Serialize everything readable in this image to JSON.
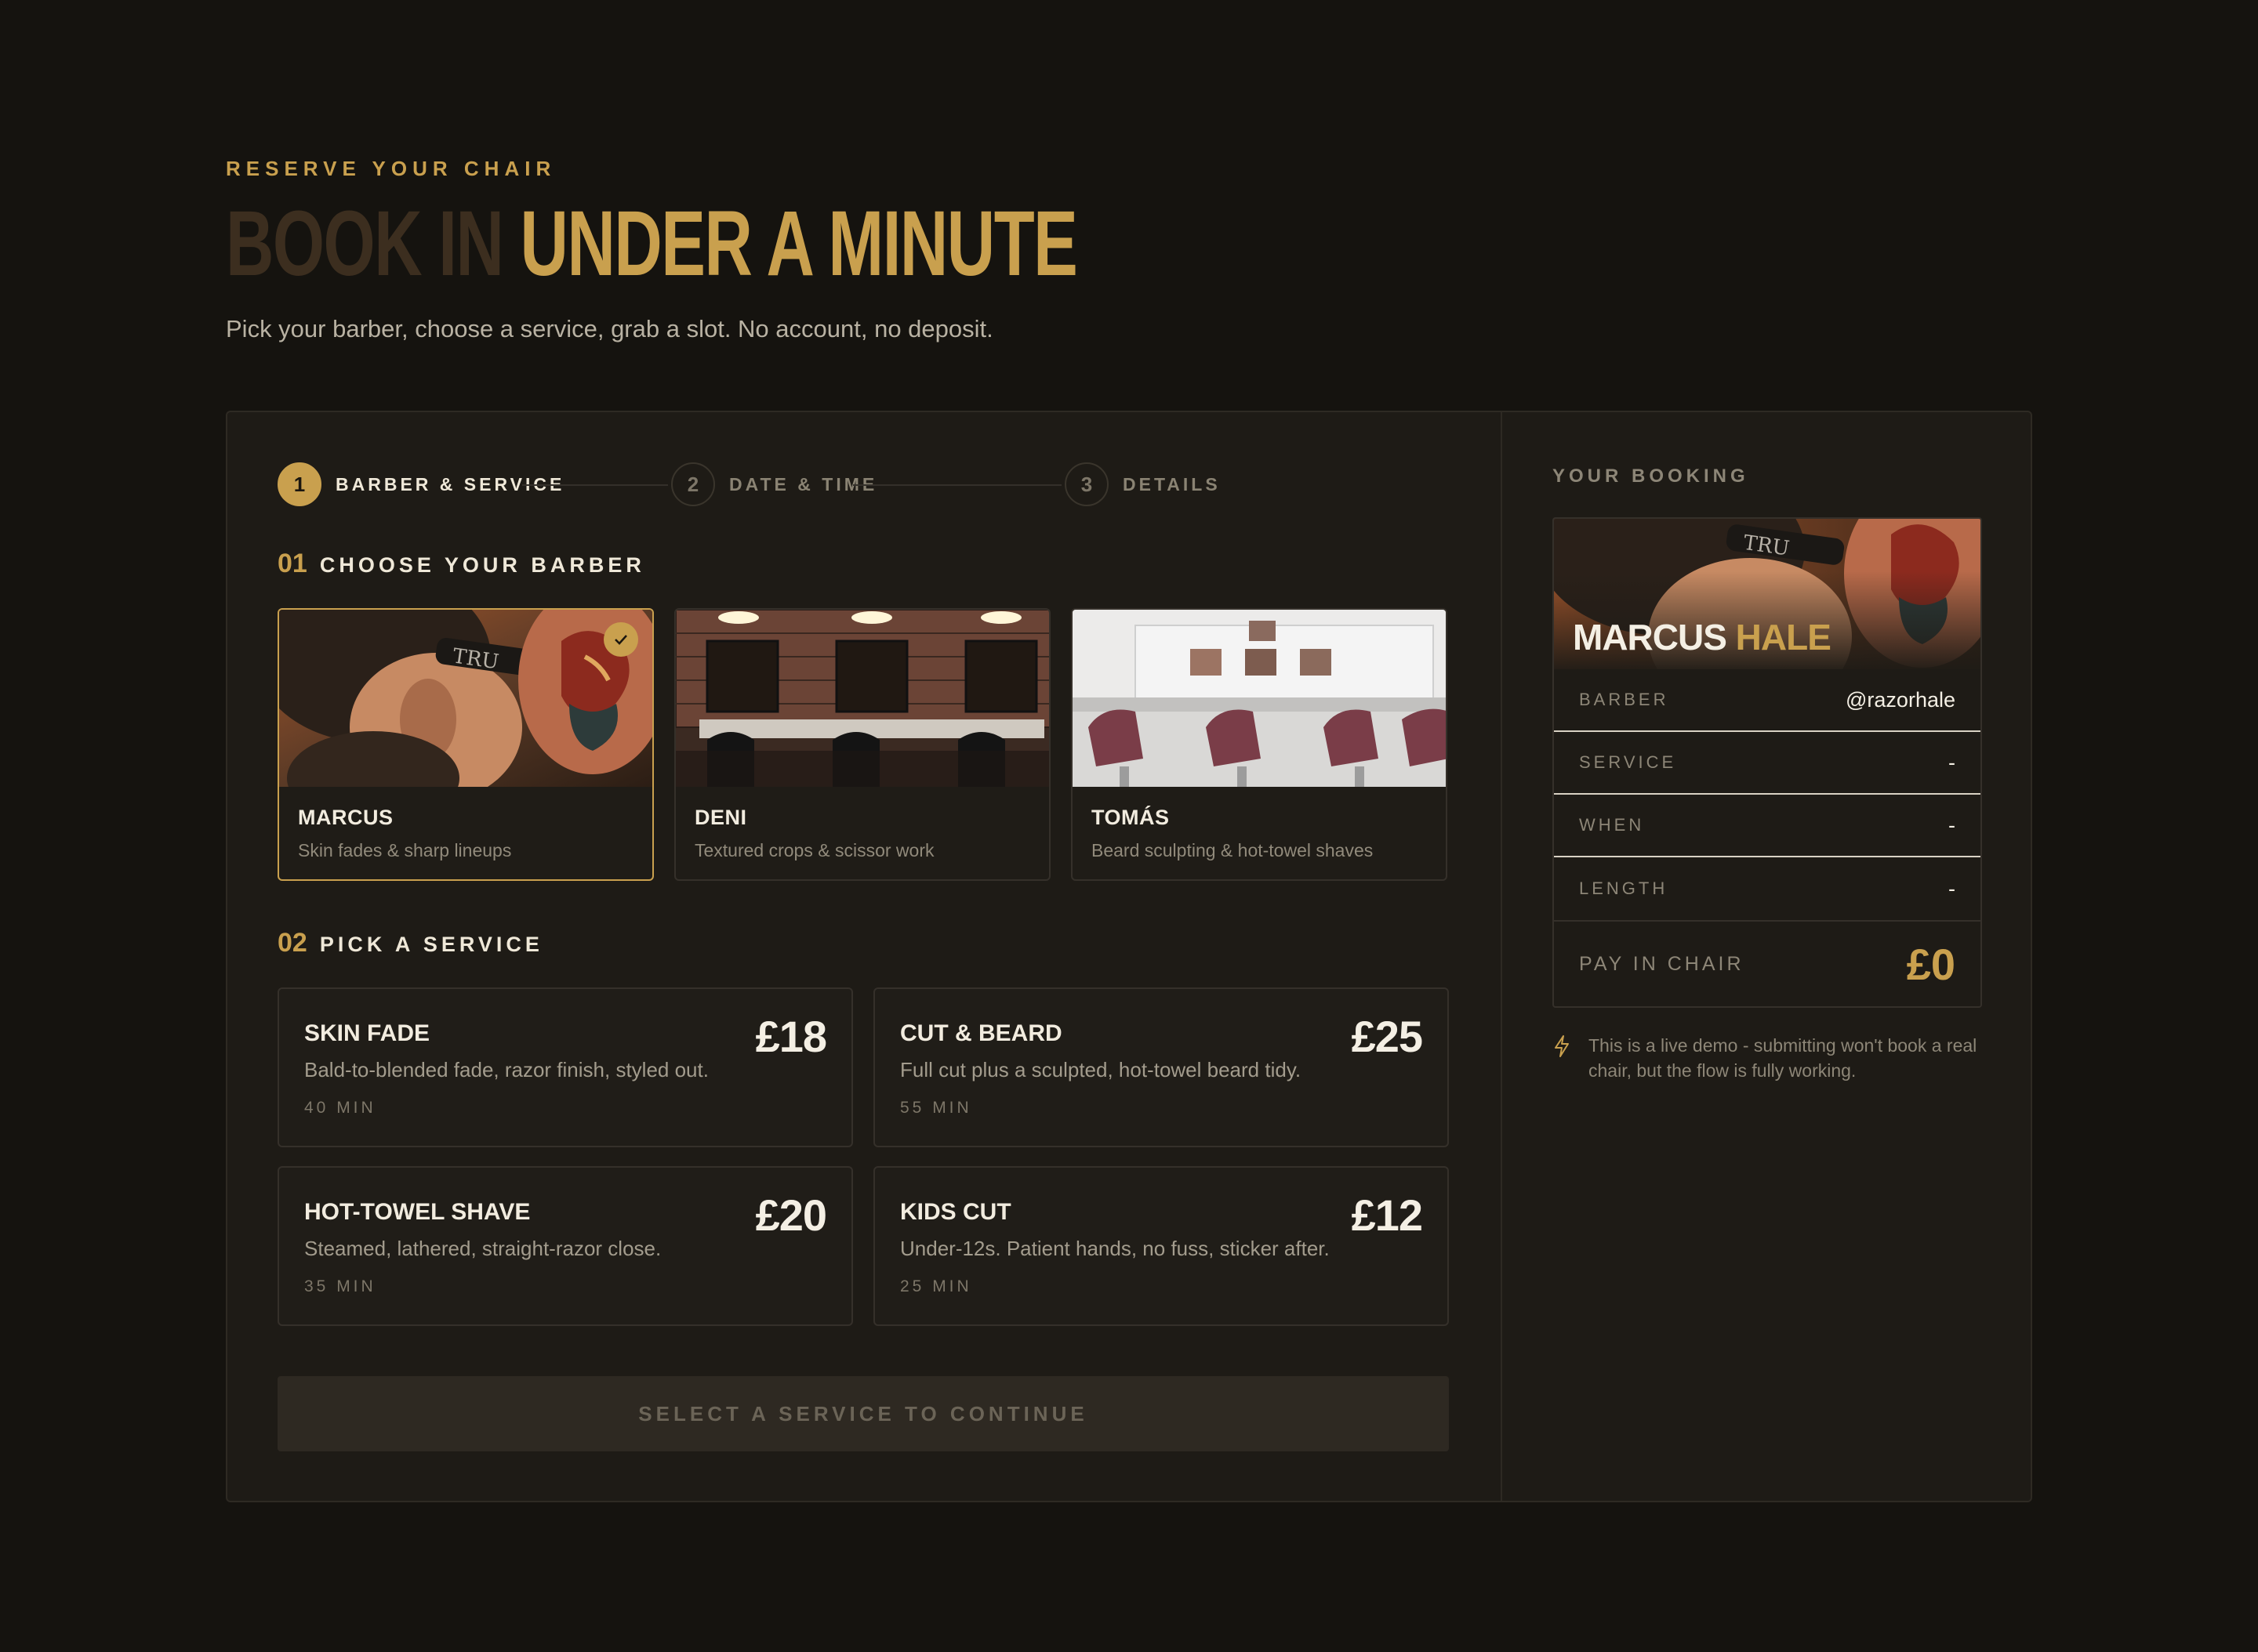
{
  "hero": {
    "eyebrow": "RESERVE YOUR CHAIR",
    "headline_dim": "BOOK IN",
    "headline_gold": "UNDER A MINUTE",
    "subhead": "Pick your barber, choose a service, grab a slot. No account, no deposit."
  },
  "stepper": [
    {
      "num": "1",
      "label": "BARBER & SERVICE",
      "active": true
    },
    {
      "num": "2",
      "label": "DATE & TIME",
      "active": false
    },
    {
      "num": "3",
      "label": "DETAILS",
      "active": false
    }
  ],
  "barber_section": {
    "num": "01",
    "title": "CHOOSE YOUR BARBER"
  },
  "barbers": [
    {
      "name": "MARCUS",
      "desc": "Skin fades & sharp lineups",
      "selected": true
    },
    {
      "name": "DENI",
      "desc": "Textured crops & scissor work",
      "selected": false
    },
    {
      "name": "TOMÁS",
      "desc": "Beard sculpting & hot-towel shaves",
      "selected": false
    }
  ],
  "service_section": {
    "num": "02",
    "title": "PICK A SERVICE"
  },
  "services": [
    {
      "name": "SKIN FADE",
      "desc": "Bald-to-blended fade, razor finish, styled out.",
      "duration": "40 MIN",
      "price": "£18"
    },
    {
      "name": "CUT & BEARD",
      "desc": "Full cut plus a sculpted, hot-towel beard tidy.",
      "duration": "55 MIN",
      "price": "£25"
    },
    {
      "name": "HOT-TOWEL SHAVE",
      "desc": "Steamed, lathered, straight-razor close.",
      "duration": "35 MIN",
      "price": "£20"
    },
    {
      "name": "KIDS CUT",
      "desc": "Under-12s. Patient hands, no fuss, sticker after.",
      "duration": "25 MIN",
      "price": "£12"
    }
  ],
  "continue_label": "SELECT A SERVICE TO CONTINUE",
  "booking": {
    "title": "YOUR BOOKING",
    "first_name": "MARCUS",
    "last_name": "HALE",
    "rows": [
      {
        "key": "BARBER",
        "value": "@razorhale"
      },
      {
        "key": "SERVICE",
        "value": "-"
      },
      {
        "key": "WHEN",
        "value": "-"
      },
      {
        "key": "LENGTH",
        "value": "-"
      }
    ],
    "total_label": "PAY IN CHAIR",
    "total_value": "£0"
  },
  "note": "This is a live demo - submitting won't book a real chair, but the flow is fully working.",
  "colors": {
    "accent": "#c9a04e",
    "background": "#15130f",
    "panel": "#1e1b16"
  }
}
